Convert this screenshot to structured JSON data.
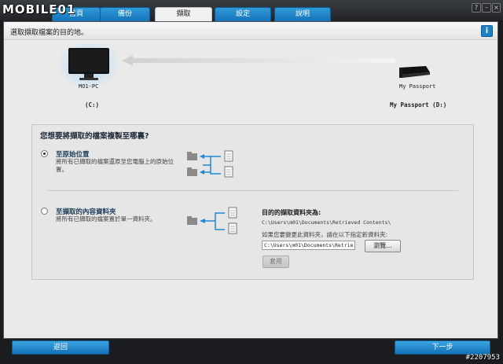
{
  "app": {
    "logo_text": "MOBILE01"
  },
  "tabs": [
    {
      "label": "首頁"
    },
    {
      "label": "備份"
    },
    {
      "label": "擷取"
    },
    {
      "label": "設定"
    },
    {
      "label": "說明"
    }
  ],
  "window": {
    "help": "?",
    "min": "–",
    "close": "×"
  },
  "header": {
    "instruction": "選取擷取檔案的目的地。",
    "info_label": "i"
  },
  "devices": {
    "source": {
      "name": "MO1-PC",
      "drive": "(C:)"
    },
    "target": {
      "name": "My Passport",
      "drive": "My Passport (D:)"
    }
  },
  "group": {
    "title": "您想要將擷取的檔案複製至哪裏?",
    "option1": {
      "title": "至原始位置",
      "desc_line1": "將所有已擷取的檔案還原至您電腦上的原始位",
      "desc_line2": "置。"
    },
    "option2": {
      "title": "至擷取的內容資料夾",
      "desc": "將所有已擷取的檔案置於單一資料夾。"
    },
    "dest": {
      "title": "目的的擷取資料夾為:",
      "path": "C:\\Users\\m01\\Documents\\Retrieved Contents\\",
      "hint": "如果您要變更此資料夾，請在以下指定新資料夾:",
      "input_value": "C:\\Users\\m01\\Documents\\Retrieve",
      "browse_label": "瀏覽...",
      "apply_label": "套用"
    }
  },
  "footer": {
    "back_label": "返回",
    "next_label": "下一步"
  },
  "watermark": "#2207953",
  "colors": {
    "accent": "#1d7fc4",
    "tab_active": "#f1f1f1",
    "background": "#eaeaea",
    "topbar": "#26282c"
  }
}
